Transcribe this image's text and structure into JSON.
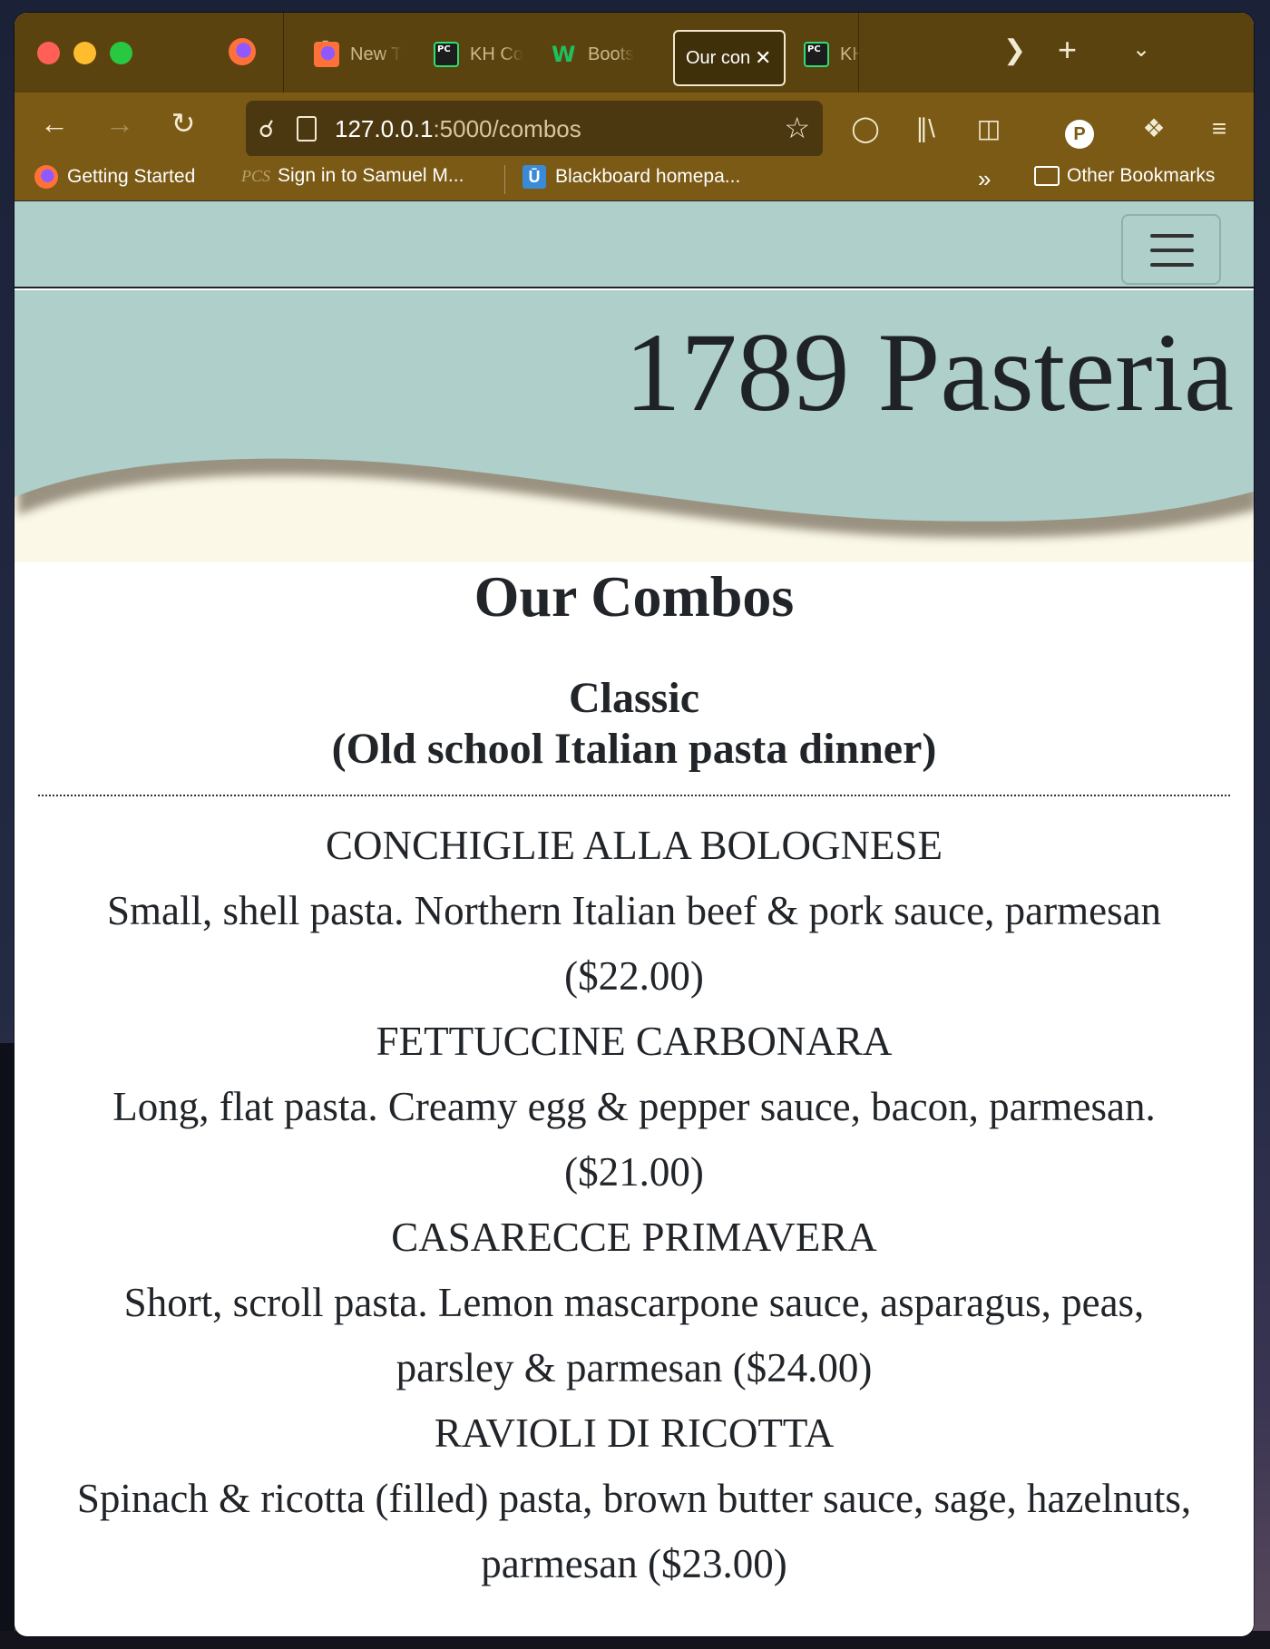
{
  "browser": {
    "tabs": [
      {
        "label": "New T",
        "icon": "firefox-icon"
      },
      {
        "label": "KH Co",
        "icon": "pycharm-icon"
      },
      {
        "label": "Boots",
        "icon": "w3schools-icon"
      },
      {
        "label": "Our con",
        "icon": "none",
        "active": true
      },
      {
        "label": "KH",
        "icon": "pycharm-icon"
      }
    ],
    "url_host": "127.0.0.1",
    "url_path": ":5000/combos",
    "profile_initial": "P",
    "bookmarks": [
      {
        "label": "Getting Started",
        "icon": "firefox-icon"
      },
      {
        "label": "Sign in to Samuel M...",
        "icon": "pcs-icon",
        "icon_text": "PCS"
      },
      {
        "label": "Blackboard homepa...",
        "icon": "blackboard-icon",
        "icon_text": "Ū"
      }
    ],
    "other_bookmarks": "Other Bookmarks"
  },
  "site": {
    "brand": "1789 Pasteria",
    "nav_color": "#aecfca",
    "cream": "#fbf8e8"
  },
  "menu": {
    "heading": "Our Combos",
    "section_title": "Classic",
    "section_subtitle": "(Old school Italian pasta dinner)",
    "items": [
      {
        "name": "CONCHIGLIE ALLA BOLOGNESE",
        "desc": "Small, shell pasta. Northern Italian beef & pork sauce, parmesan",
        "price": "($22.00)"
      },
      {
        "name": "FETTUCCINE CARBONARA",
        "desc": "Long, flat pasta. Creamy egg & pepper sauce, bacon, parmesan.",
        "price": "($21.00)"
      },
      {
        "name": "CASARECCE PRIMAVERA",
        "desc1": "Short, scroll pasta. Lemon mascarpone sauce, asparagus, peas,",
        "desc2": "parsley & parmesan ($24.00)"
      },
      {
        "name": "RAVIOLI DI RICOTTA",
        "desc1": "Spinach & ricotta (filled) pasta, brown butter sauce, sage, hazelnuts,",
        "desc2": "parmesan ($23.00)"
      }
    ]
  }
}
